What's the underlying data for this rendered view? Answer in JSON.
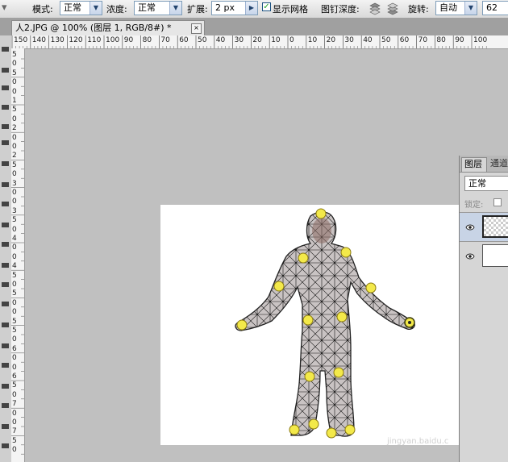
{
  "options_bar": {
    "mode_label": "模式:",
    "mode_value": "正常",
    "density_label": "浓度:",
    "density_value": "正常",
    "expansion_label": "扩展:",
    "expansion_value": "2 px",
    "show_mesh_label": "显示网格",
    "show_mesh_checked": true,
    "pin_depth_label": "图钉深度:",
    "rotation_label": "旋转:",
    "rotation_value": "自动",
    "angle_value": "62"
  },
  "document_tab": {
    "title": "人2.JPG @ 100% (图层 1, RGB/8#) *",
    "close_glyph": "×"
  },
  "rulers": {
    "horizontal_ticks": [
      "150",
      "140",
      "130",
      "120",
      "110",
      "100",
      "90",
      "80",
      "70",
      "60",
      "50",
      "40",
      "30",
      "20",
      "10",
      "0",
      "10",
      "20",
      "30",
      "40",
      "50",
      "60",
      "70",
      "80",
      "90",
      "100"
    ],
    "vertical_ticks": [
      "5",
      "0",
      "5",
      "0",
      "0",
      "1",
      "5",
      "0",
      "2",
      "0",
      "0",
      "2",
      "5",
      "0",
      "3",
      "0",
      "0",
      "3",
      "5",
      "0",
      "4",
      "0",
      "0",
      "4",
      "5",
      "0",
      "5",
      "0",
      "0",
      "5",
      "5",
      "0",
      "6",
      "0",
      "0",
      "6",
      "5",
      "0",
      "7",
      "0",
      "0",
      "7",
      "5",
      "0"
    ]
  },
  "canvas": {
    "watermark": "jingyan.baidu.c"
  },
  "layers_panel": {
    "tab_layers": "图层",
    "tab_channels": "通道",
    "blend_mode": "正常",
    "lock_label": "锁定:",
    "eye_glyph": "👁"
  },
  "colors": {
    "pin_yellow": "#f3e94a",
    "mesh_line": "#000000",
    "canvas_bg": "#ffffff",
    "workspace_bg": "#c0c0c0"
  }
}
